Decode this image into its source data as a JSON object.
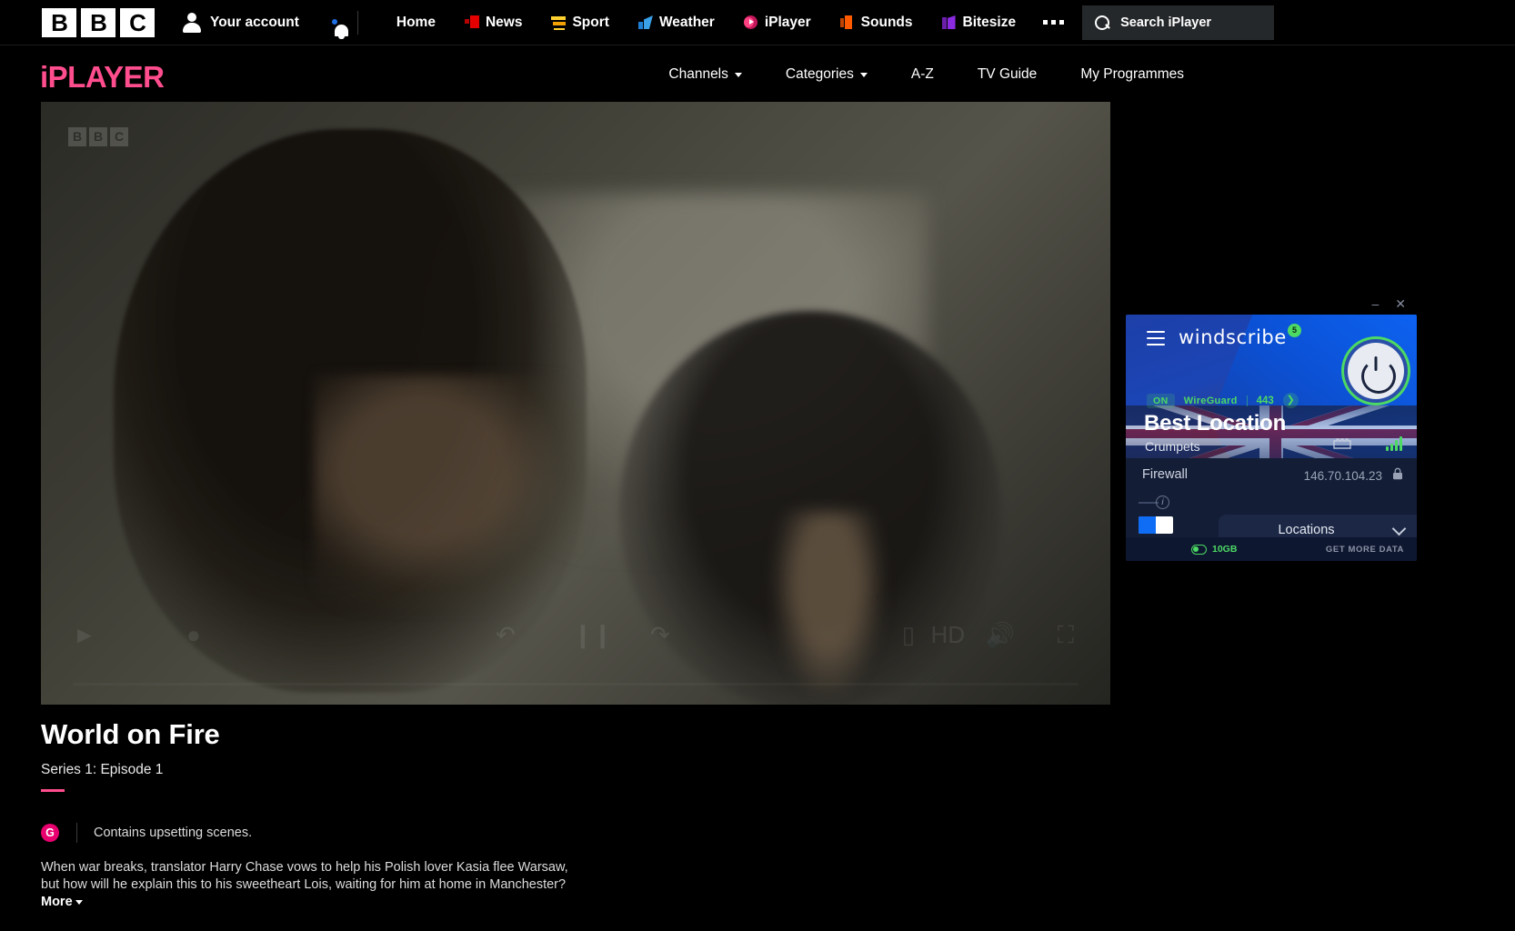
{
  "bbc_nav": {
    "logo_letters": [
      "B",
      "B",
      "C"
    ],
    "account_label": "Your account",
    "notifications_icon": "bell-icon",
    "items": [
      {
        "label": "Home",
        "icon": ""
      },
      {
        "label": "News",
        "icon": "news-icon"
      },
      {
        "label": "Sport",
        "icon": "sport-icon"
      },
      {
        "label": "Weather",
        "icon": "weather-icon"
      },
      {
        "label": "iPlayer",
        "icon": "iplayer-icon"
      },
      {
        "label": "Sounds",
        "icon": "sounds-icon"
      },
      {
        "label": "Bitesize",
        "icon": "bitesize-icon"
      }
    ],
    "more_label": "More menu",
    "search": {
      "placeholder": "Search iPlayer",
      "value": "Search iPlayer",
      "icon": "search-icon"
    }
  },
  "iplayer_nav": {
    "logo": "iPLAYER",
    "logo_color": "#ff4d8d",
    "items": [
      {
        "label": "Channels",
        "has_caret": true
      },
      {
        "label": "Categories",
        "has_caret": true
      },
      {
        "label": "A-Z",
        "has_caret": false
      },
      {
        "label": "TV Guide",
        "has_caret": false
      },
      {
        "label": "My Programmes",
        "has_caret": false
      }
    ]
  },
  "player": {
    "watermark": [
      "B",
      "B",
      "C"
    ],
    "controls": [
      "rewind-icon",
      "pause-icon",
      "forward-icon",
      "subtitles-icon",
      "quality-icon",
      "volume-icon",
      "fullscreen-icon"
    ]
  },
  "programme": {
    "title": "World on Fire",
    "subtitle": "Series 1: Episode 1",
    "guidance_badge": "G",
    "guidance_text": "Contains upsetting scenes.",
    "synopsis": "When war breaks, translator Harry Chase vows to help his Polish lover Kasia flee Warsaw, but how will he explain this to his sweetheart Lois, waiting for him at home in Manchester?",
    "more_label": "More"
  },
  "windscribe": {
    "window_controls": {
      "minimize": "–",
      "close": "✕"
    },
    "menu_icon": "hamburger-icon",
    "brand": "windscribe",
    "badge": "5",
    "power_icon": "power-button-icon",
    "status": {
      "state": "ON",
      "protocol": "WireGuard",
      "port": "443",
      "expand_icon": "chevron-right-icon"
    },
    "location": "Best Location",
    "city": "Crumpets",
    "signal_icon": "signal-bars-icon",
    "server_icon": "server-rack-icon",
    "firewall_label": "Firewall",
    "ip_address": "146.70.104.23",
    "lock_icon": "lock-icon",
    "info_icon": "info-icon",
    "toggle_state": "on",
    "locations_label": "Locations",
    "locations_chevron": "chevron-down-icon",
    "data_amount": "10GB",
    "get_more_data": "GET MORE DATA",
    "accent_green": "#4cd964",
    "accent_blue": "#0f6cf5"
  }
}
